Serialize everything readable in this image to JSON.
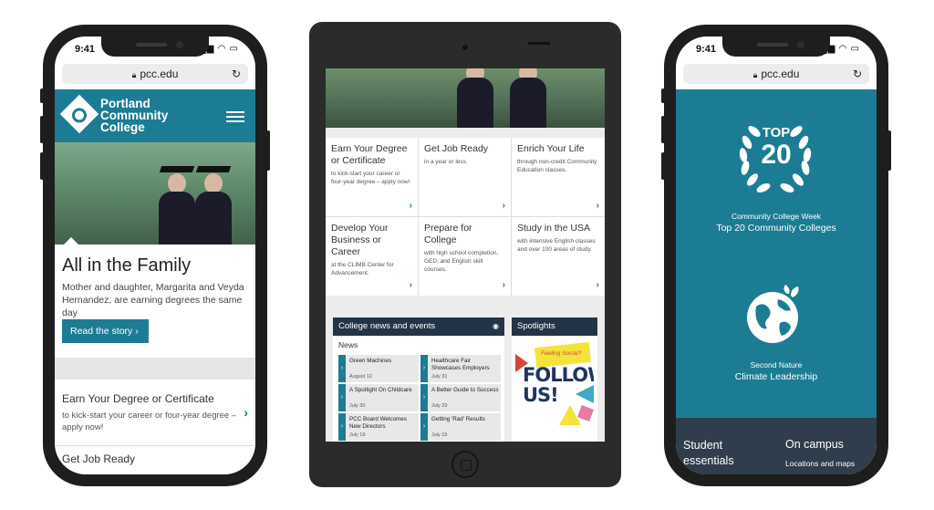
{
  "status_bar": {
    "time": "9:41",
    "icons": "▂▄▆ ◠ ▭"
  },
  "browser": {
    "url": "pcc.edu",
    "lock_icon": "lock-icon",
    "reload_icon": "reload-icon"
  },
  "left_phone": {
    "logo_lines": [
      "Portland",
      "Community",
      "College"
    ],
    "hero_title": "All in the Family",
    "hero_desc": "Mother and daughter, Margarita and Veyda Hernandez, are earning degrees the same day",
    "cta_label": "Read the story ›",
    "item1_title": "Earn Your Degree or Certificate",
    "item1_desc": "to kick-start your career or four-year degree – apply now!",
    "item2_title": "Get Job Ready"
  },
  "tablet": {
    "cells": [
      {
        "title": "Earn Your Degree or Certificate",
        "desc": "to kick-start your career or four-year degree – apply now!"
      },
      {
        "title": "Get Job Ready",
        "desc": "in a year or less."
      },
      {
        "title": "Enrich Your Life",
        "desc": "through non-credit Community Education classes."
      },
      {
        "title": "Develop Your Business or Career",
        "desc": "at the CLIMB Center for Advancement."
      },
      {
        "title": "Prepare for College",
        "desc": "with high school completion, GED, and English skill courses."
      },
      {
        "title": "Study in the USA",
        "desc": "with intensive English classes and over 100 areas of study."
      }
    ],
    "news_header": "College news and events",
    "news_label": "News",
    "news_items": [
      {
        "title": "Green Machines",
        "date": "August 12"
      },
      {
        "title": "Healthcare Fair Showcases Employers",
        "date": "July 31"
      },
      {
        "title": "A Spotlight On Childcare",
        "date": "July 30"
      },
      {
        "title": "A Better Guide to Success",
        "date": "July 29"
      },
      {
        "title": "PCC Board Welcomes New Directors",
        "date": "July 19"
      },
      {
        "title": "Getting 'Rad' Results",
        "date": "July 15"
      }
    ],
    "spotlights_header": "Spotlights",
    "poster_tag": "Feeling Social?",
    "poster_text": "FOLLOW US!"
  },
  "right_phone": {
    "badge_top": "TOP",
    "badge_num": "20",
    "cap1": "Community College Week",
    "cap2": "Top 20 Community Colleges",
    "cap3": "Second Nature",
    "cap4": "Climate Leadership",
    "student_essentials": "Student essentials",
    "on_campus": "On campus",
    "locations_maps": "Locations and maps"
  },
  "colors": {
    "brand_teal": "#1c7c93",
    "navy": "#243447",
    "dark_footer": "#2f3d4c"
  }
}
